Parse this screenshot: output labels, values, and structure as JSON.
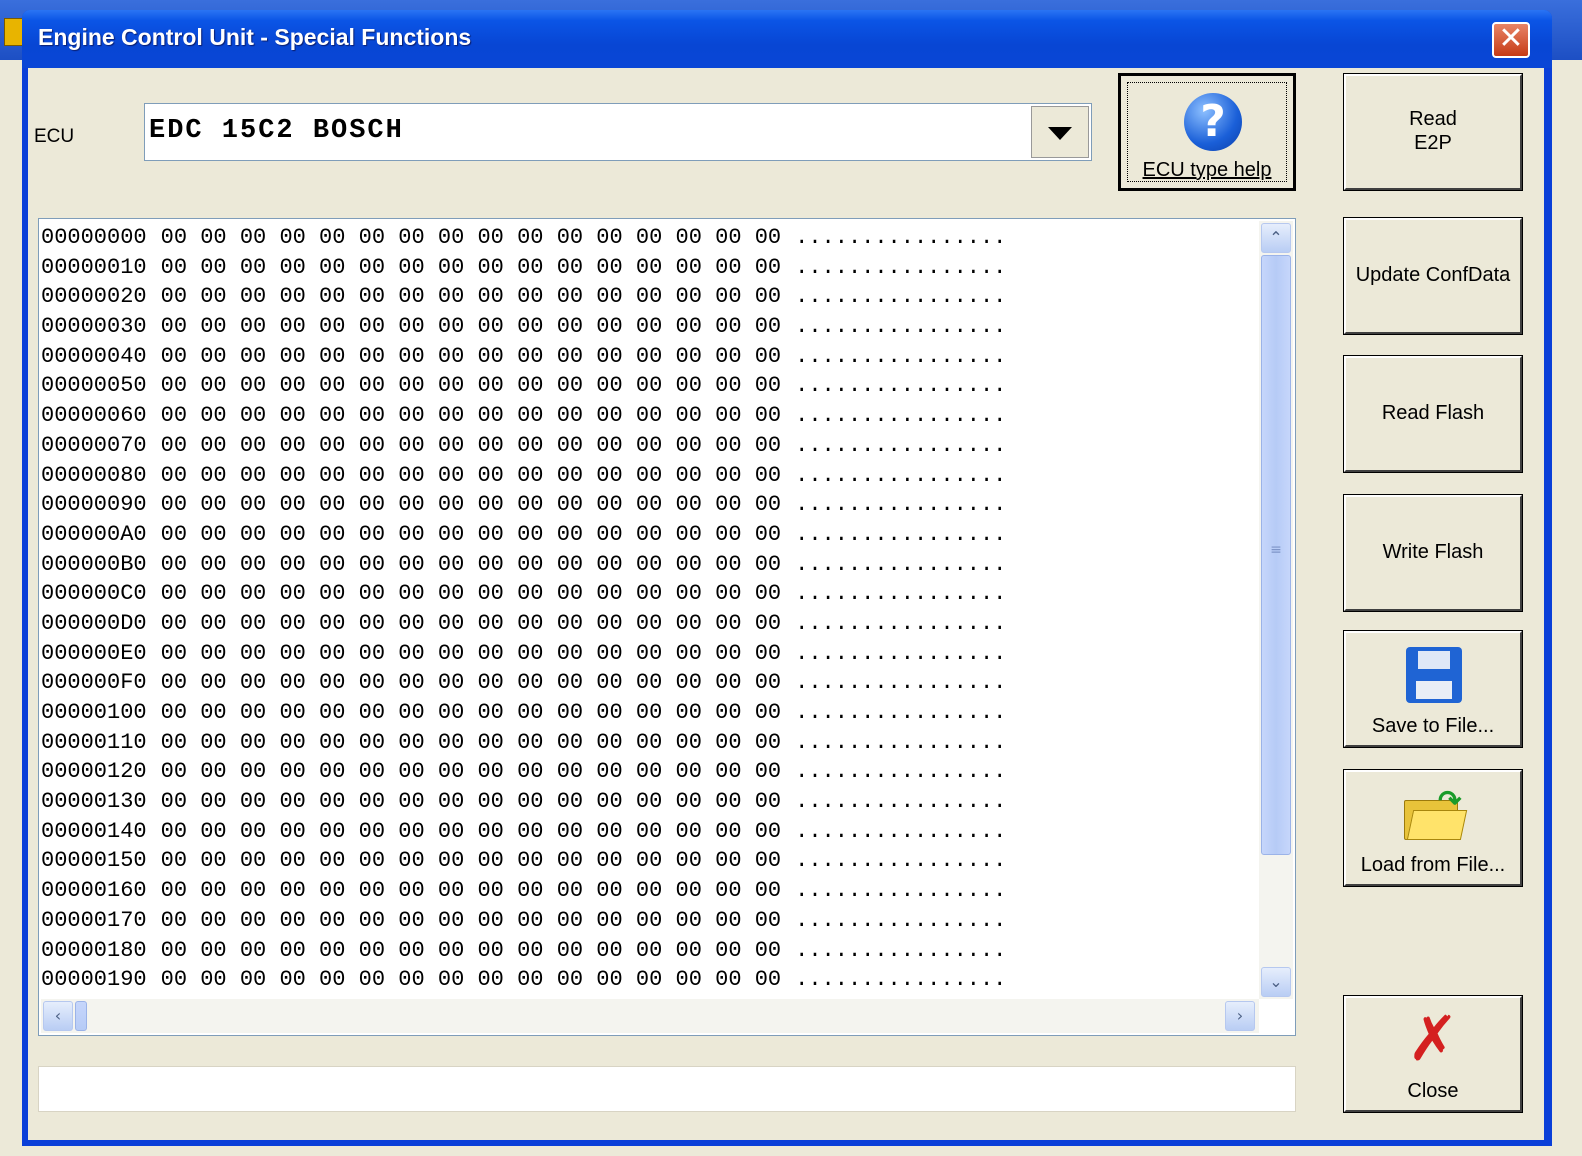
{
  "window": {
    "title": "Engine Control Unit - Special Functions",
    "close_glyph": "✕"
  },
  "ecu": {
    "label": "ECU",
    "selected": "EDC 15C2 BOSCH",
    "dropdown_icon": "chevron-down-icon"
  },
  "help_button": {
    "label": "ECU type help",
    "icon": "question-icon",
    "icon_glyph": "?"
  },
  "side_buttons": {
    "read_e2p": {
      "line1": "Read",
      "line2": "E2P"
    },
    "update_confdata": "Update ConfData",
    "read_flash": "Read Flash",
    "write_flash": "Write Flash",
    "save_to_file": {
      "label": "Save to File...",
      "icon": "floppy-disk-icon"
    },
    "load_from_file": {
      "label": "Load from File...",
      "icon": "open-folder-icon"
    },
    "close": {
      "label": "Close",
      "icon": "red-x-icon",
      "glyph": "✗"
    }
  },
  "hex_dump": {
    "addresses": [
      "00000000",
      "00000010",
      "00000020",
      "00000030",
      "00000040",
      "00000050",
      "00000060",
      "00000070",
      "00000080",
      "00000090",
      "000000A0",
      "000000B0",
      "000000C0",
      "000000D0",
      "000000E0",
      "000000F0",
      "00000100",
      "00000110",
      "00000120",
      "00000130",
      "00000140",
      "00000150",
      "00000160",
      "00000170",
      "00000180",
      "00000190"
    ],
    "bytes": "00 00 00 00 00 00 00 00 00 00 00 00 00 00 00 00",
    "ascii": "................"
  },
  "scrollbars": {
    "up_glyph": "⌃",
    "down_glyph": "⌄",
    "left_glyph": "‹",
    "right_glyph": "›",
    "grip_glyph": "≡"
  },
  "status": {
    "text": ""
  }
}
